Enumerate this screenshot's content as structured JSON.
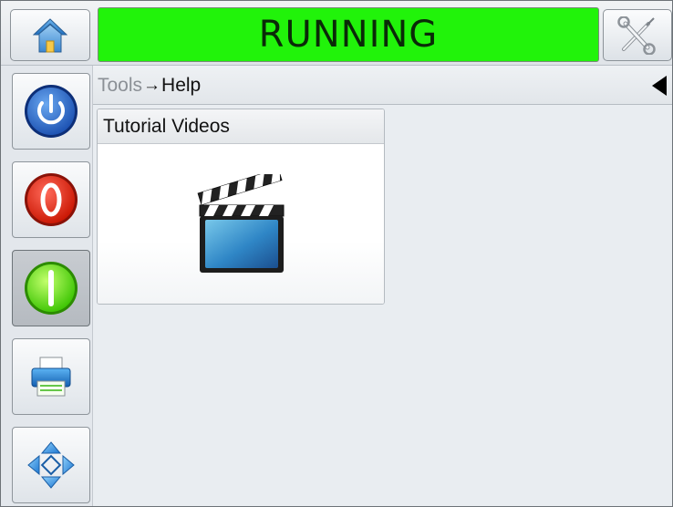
{
  "header": {
    "status": "RUNNING",
    "status_color": "#21f30a",
    "home_icon": "home-icon",
    "tools_icon": "tools-icon"
  },
  "sidebar": {
    "items": [
      {
        "icon": "power-icon",
        "state": "normal"
      },
      {
        "icon": "stop-icon",
        "state": "normal"
      },
      {
        "icon": "start-icon",
        "state": "pressed"
      },
      {
        "icon": "printer-icon",
        "state": "normal"
      },
      {
        "icon": "navigation-icon",
        "state": "normal"
      }
    ]
  },
  "breadcrumb": {
    "parent": "Tools",
    "separator": "→",
    "current": "Help"
  },
  "tiles": [
    {
      "title": "Tutorial Videos",
      "icon": "clapperboard-icon"
    }
  ]
}
